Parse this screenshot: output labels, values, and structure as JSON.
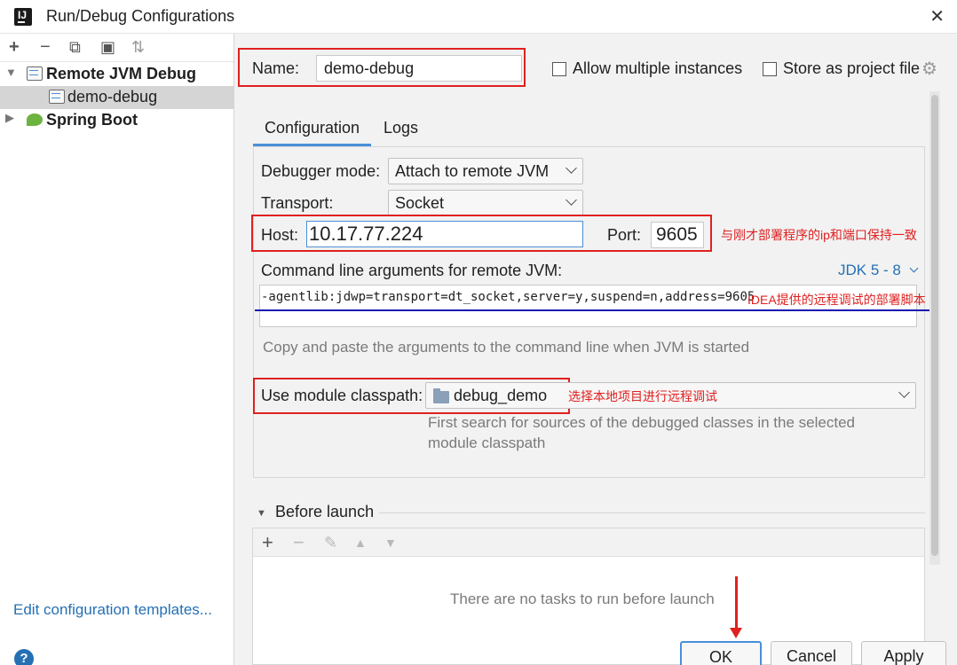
{
  "window": {
    "title": "Run/Debug Configurations",
    "close_glyph": "✕"
  },
  "left": {
    "toolbar": [
      {
        "name": "add-icon",
        "glyph": "+"
      },
      {
        "name": "remove-icon",
        "glyph": "−"
      },
      {
        "name": "copy-icon",
        "glyph": "⧉"
      },
      {
        "name": "folder-add-icon",
        "glyph": "▣"
      },
      {
        "name": "sort-icon",
        "glyph": "⇅"
      }
    ],
    "tree": [
      {
        "label": "Remote JVM Debug",
        "expanded": true
      },
      {
        "label": "demo-debug",
        "selected": true
      },
      {
        "label": "Spring Boot",
        "expanded": false
      }
    ],
    "edit_templates": "Edit configuration templates...",
    "help": "?"
  },
  "right": {
    "name_label": "Name:",
    "name_value": "demo-debug",
    "allow_multiple": "Allow multiple instances",
    "store_project": "Store as project file",
    "tabs": [
      "Configuration",
      "Logs"
    ],
    "debugger_mode_label": "Debugger mode:",
    "debugger_mode_value": "Attach to remote JVM",
    "transport_label": "Transport:",
    "transport_value": "Socket",
    "host_label": "Host:",
    "host_value": "10.17.77.224",
    "port_label": "Port:",
    "port_value": "9605",
    "host_port_note": "与刚才部署程序的ip和端口保持一致",
    "cmd_label": "Command line arguments for remote JVM:",
    "jdk_select": "JDK 5 - 8",
    "cmd_value": "-agentlib:jdwp=transport=dt_socket,server=y,suspend=n,address=9605",
    "cmd_note": "IDEA提供的远程调试的部署脚本",
    "cmd_hint": "Copy and paste the arguments to the command line when JVM is started",
    "module_label": "Use module classpath:",
    "module_value": "debug_demo",
    "module_note": "选择本地项目进行远程调试",
    "module_hint_1": "First search for sources of the debugged classes in the selected",
    "module_hint_2": "module classpath",
    "before_launch": "Before launch",
    "before_launch_empty": "There are no tasks to run before launch"
  },
  "buttons": {
    "ok": "OK",
    "cancel": "Cancel",
    "apply": "Apply"
  },
  "colors": {
    "annotation": "#e02020",
    "accent": "#4a8fd8",
    "link": "#2470b3",
    "underline": "#1a1ab5"
  }
}
